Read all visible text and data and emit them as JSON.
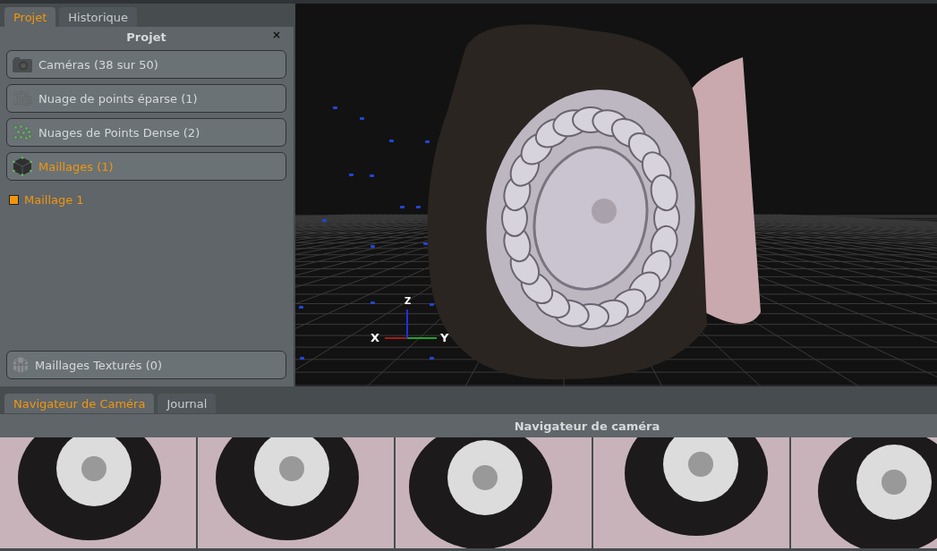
{
  "left_tabs": [
    {
      "label": "Projet",
      "selected": true
    },
    {
      "label": "Historique",
      "selected": false
    }
  ],
  "project_panel": {
    "title": "Projet",
    "close": "×",
    "items": [
      {
        "kind": "camera",
        "label": "Caméras (38 sur 50)",
        "selected": false
      },
      {
        "kind": "sparse",
        "label": "Nuage de points éparse (1)",
        "selected": false
      },
      {
        "kind": "dense",
        "label": "Nuages de Points Dense (2)",
        "selected": false
      },
      {
        "kind": "mesh",
        "label": "Maillages (1)",
        "selected": true,
        "children": [
          {
            "label": "Maillage 1",
            "color": "#f0960e"
          }
        ]
      }
    ],
    "bottom_item": {
      "kind": "textured",
      "label": "Maillages Texturés (0)",
      "selected": false
    }
  },
  "viewport": {
    "axes": {
      "x": "X",
      "y": "Y",
      "z": "Z"
    }
  },
  "bottom_tabs": [
    {
      "label": "Navigateur de Caméra",
      "selected": true
    },
    {
      "label": "Journal",
      "selected": false
    }
  ],
  "camera_browser": {
    "title": "Navigateur de caméra"
  }
}
